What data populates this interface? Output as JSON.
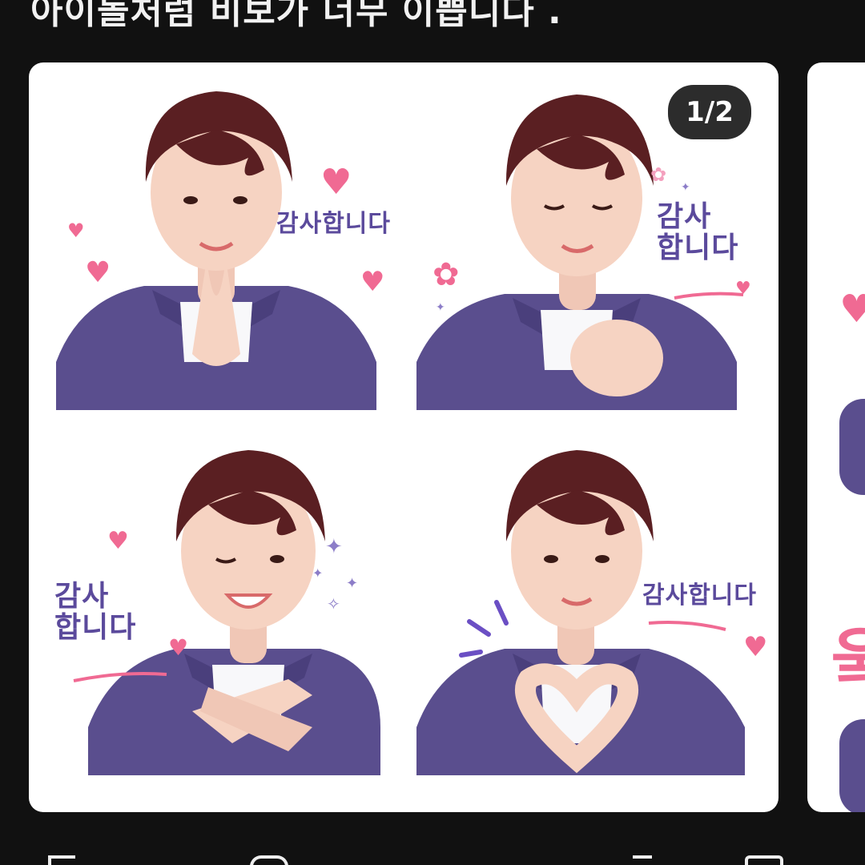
{
  "headline": "아이돌처럼 비보가 너무 이쁩니다 .",
  "gallery": {
    "counter": "1/2",
    "stickers": [
      {
        "text": "감사합니다"
      },
      {
        "text": "감사\n합니다"
      },
      {
        "text": "감사\n합니다"
      },
      {
        "text": "감사합니다"
      }
    ],
    "next_card_peek_text": "웈"
  },
  "colors": {
    "background": "#111111",
    "card": "#ffffff",
    "sweater": "#5a4e8e",
    "hair": "#5a1f22",
    "skin": "#f6d3c2",
    "text_purple": "#5b4a9c",
    "heart_pink": "#f06a93"
  },
  "icons": [
    "heart-icon",
    "flower-icon",
    "sparkle-icon"
  ]
}
